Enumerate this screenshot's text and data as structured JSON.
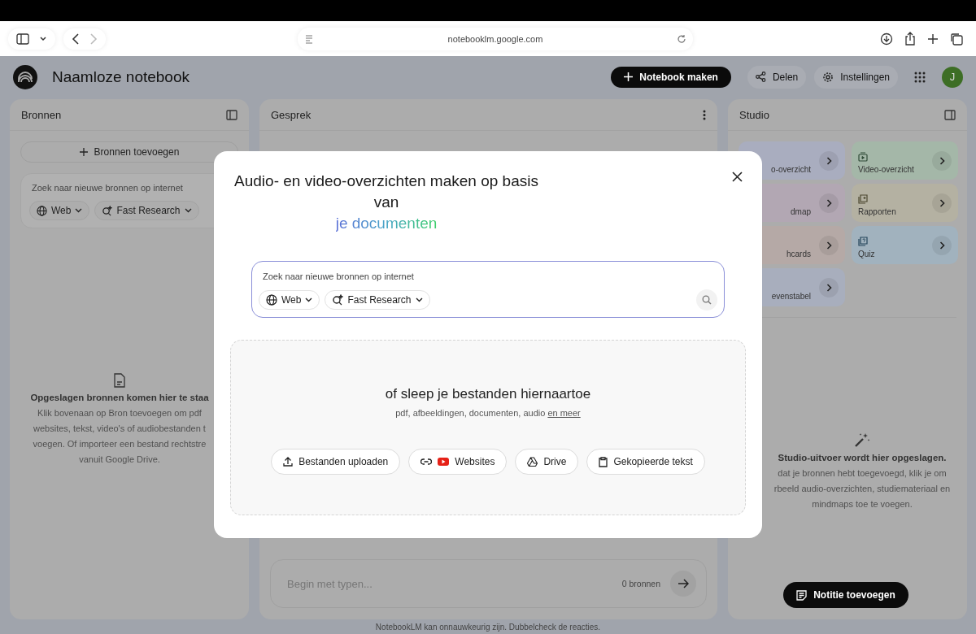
{
  "browser": {
    "url": "notebooklm.google.com"
  },
  "header": {
    "title": "Naamloze notebook",
    "create_button": "Notebook maken",
    "share_button": "Delen",
    "settings_button": "Instellingen",
    "avatar": "J"
  },
  "sources_panel": {
    "title": "Bronnen",
    "add_button": "Bronnen toevoegen",
    "search": {
      "placeholder": "Zoek naar nieuwe bronnen op internet",
      "chips": [
        "Web",
        "Fast Research"
      ]
    },
    "empty_title": "Opgeslagen bronnen komen hier te staa",
    "empty_lines": [
      "Klik bovenaan op Bron toevoegen om pdf",
      "websites, tekst, video's of audiobestanden t",
      "voegen. Of importeer een bestand rechtstre",
      "vanuit Google Drive."
    ]
  },
  "chat_panel": {
    "title": "Gesprek",
    "input_placeholder": "Begin met typen...",
    "source_count": "0 bronnen"
  },
  "studio_panel": {
    "title": "Studio",
    "cards": [
      {
        "label": "o-overzicht",
        "kind": "partial",
        "color": "#a9adbf"
      },
      {
        "label": "Video-overzicht",
        "kind": "full",
        "color": "#a4b7a8"
      },
      {
        "label": "dmap",
        "kind": "partial",
        "color": "#b2a7b3"
      },
      {
        "label": "Rapporten",
        "kind": "full",
        "color": "#b4b1a2"
      },
      {
        "label": "hcards",
        "kind": "partial",
        "color": "#b5a9a6"
      },
      {
        "label": "Quiz",
        "kind": "full",
        "color": "#a1b2be"
      },
      {
        "label": "evenstabel",
        "kind": "partial",
        "color": "#a8aebd"
      }
    ],
    "empty_title": "Studio-uitvoer wordt hier opgeslagen.",
    "empty_lines": [
      "dat je bronnen hebt toegevoegd, klik je om",
      "rbeeld audio-overzichten, studiemateriaal en",
      "mindmaps toe te voegen."
    ],
    "note_button": "Notitie toevoegen"
  },
  "footer": "NotebookLM kan onnauwkeurig zijn. Dubbelcheck de reacties.",
  "dialog": {
    "title": "Audio- en video-overzichten maken op basis van",
    "title_highlight": "je documenten",
    "search": {
      "placeholder": "Zoek naar nieuwe bronnen op internet",
      "chips": [
        "Web",
        "Fast Research"
      ]
    },
    "drop_title": "of sleep je bestanden hiernaartoe",
    "drop_hint": "pdf, afbeeldingen, documenten, audio",
    "drop_link": "en meer",
    "buttons": [
      "Bestanden uploaden",
      "Websites",
      "Drive",
      "Gekopieerde tekst"
    ]
  }
}
